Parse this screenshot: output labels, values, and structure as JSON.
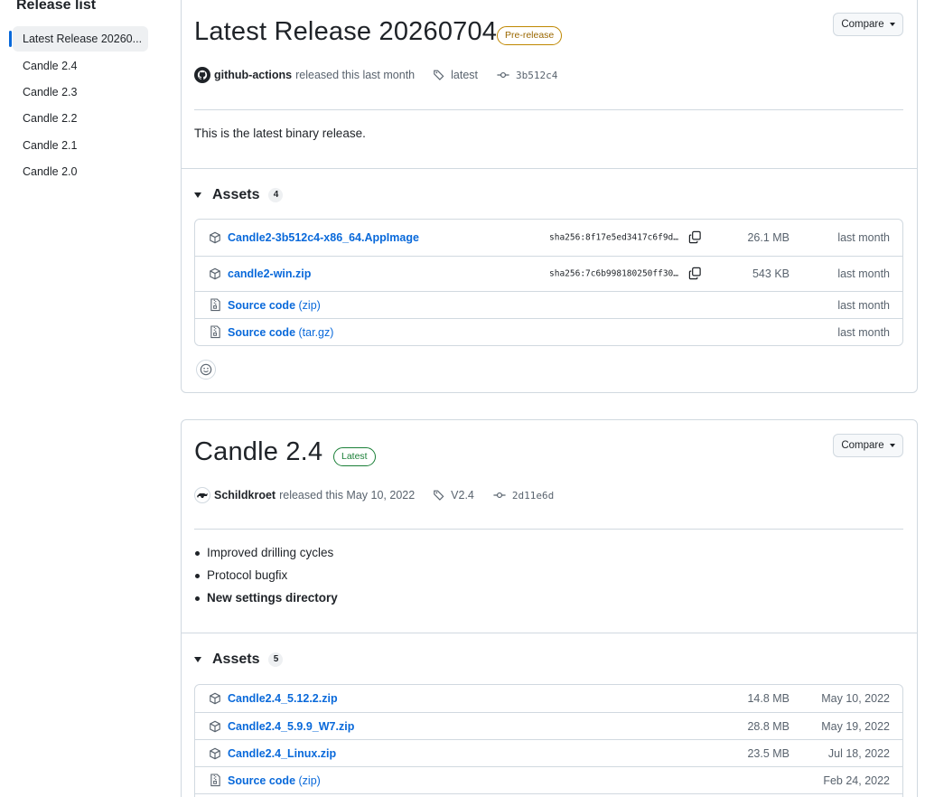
{
  "sidebar": {
    "title": "Release list",
    "items": [
      {
        "label": "Latest Release 20260..."
      },
      {
        "label": "Candle 2.4"
      },
      {
        "label": "Candle 2.3"
      },
      {
        "label": "Candle 2.2"
      },
      {
        "label": "Candle 2.1"
      },
      {
        "label": "Candle 2.0"
      }
    ]
  },
  "releases": [
    {
      "title": "Latest Release 20260704",
      "badge": "Pre-release",
      "compare_label": "Compare",
      "author": "github-actions",
      "released_text": "released this last month",
      "tag": "latest",
      "commit": "3b512c4",
      "description": "This is the latest binary release.",
      "assets_label": "Assets",
      "assets_count": "4",
      "assets": [
        {
          "name": "Candle2-3b512c4-x86_64.AppImage",
          "suffix": "",
          "hash": "sha256:8f17e5ed3417c6f9d…",
          "size": "26.1 MB",
          "date": "last month",
          "icon": "package-icon"
        },
        {
          "name": "candle2-win.zip",
          "suffix": "",
          "hash": "sha256:7c6b998180250ff30…",
          "size": "543 KB",
          "date": "last month",
          "icon": "package-icon"
        },
        {
          "name": "Source code",
          "suffix": "(zip)",
          "hash": "",
          "size": "",
          "date": "last month",
          "icon": "file-zip-icon"
        },
        {
          "name": "Source code",
          "suffix": "(tar.gz)",
          "hash": "",
          "size": "",
          "date": "last month",
          "icon": "file-zip-icon"
        }
      ]
    },
    {
      "title": "Candle 2.4",
      "badge": "Latest",
      "compare_label": "Compare",
      "author": "Schildkroet",
      "released_text": "released this May 10, 2022",
      "tag": "V2.4",
      "commit": "2d11e6d",
      "notes": [
        {
          "text": "Improved drilling cycles",
          "bold": false
        },
        {
          "text": "Protocol bugfix",
          "bold": false
        },
        {
          "text": "New settings directory",
          "bold": true
        }
      ],
      "assets_label": "Assets",
      "assets_count": "5",
      "assets": [
        {
          "name": "Candle2.4_5.12.2.zip",
          "suffix": "",
          "size": "14.8 MB",
          "date": "May 10, 2022",
          "icon": "package-icon"
        },
        {
          "name": "Candle2.4_5.9.9_W7.zip",
          "suffix": "",
          "size": "28.8 MB",
          "date": "May 19, 2022",
          "icon": "package-icon"
        },
        {
          "name": "Candle2.4_Linux.zip",
          "suffix": "",
          "size": "23.5 MB",
          "date": "Jul 18, 2022",
          "icon": "package-icon"
        },
        {
          "name": "Source code",
          "suffix": "(zip)",
          "size": "",
          "date": "Feb 24, 2022",
          "icon": "file-zip-icon"
        }
      ]
    }
  ],
  "colors": {
    "link": "#0969da",
    "prerelease": "#9a6700",
    "latest": "#1a7f37",
    "border": "#d1d9e0",
    "muted": "#59636e"
  }
}
